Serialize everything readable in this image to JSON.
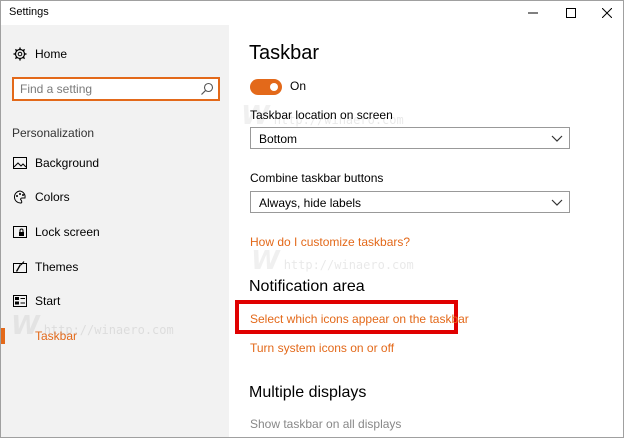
{
  "window": {
    "title": "Settings",
    "controls": {
      "minimize": "—",
      "maximize": "☐",
      "close": "✕"
    }
  },
  "sidebar": {
    "home_label": "Home",
    "search_placeholder": "Find a setting",
    "section_heading": "Personalization",
    "items": [
      {
        "label": "Background",
        "icon": "picture-icon"
      },
      {
        "label": "Colors",
        "icon": "palette-icon"
      },
      {
        "label": "Lock screen",
        "icon": "lock-screen-icon"
      },
      {
        "label": "Themes",
        "icon": "themes-icon"
      },
      {
        "label": "Start",
        "icon": "start-icon"
      },
      {
        "label": "Taskbar",
        "icon": "taskbar-icon",
        "selected": true
      }
    ]
  },
  "main": {
    "title": "Taskbar",
    "toggle_label": "On",
    "toggle_on": true,
    "location_label": "Taskbar location on screen",
    "location_value": "Bottom",
    "combine_label": "Combine taskbar buttons",
    "combine_value": "Always, hide labels",
    "customize_link": "How do I customize taskbars?",
    "notification_heading": "Notification area",
    "select_icons_link": "Select which icons appear on the taskbar",
    "system_icons_link": "Turn system icons on or off",
    "multiple_displays_heading": "Multiple displays",
    "show_all_displays_label": "Show taskbar on all displays"
  },
  "watermark": "http://winaero.com",
  "colors": {
    "accent": "#e3691a",
    "highlight": "#e00000"
  }
}
